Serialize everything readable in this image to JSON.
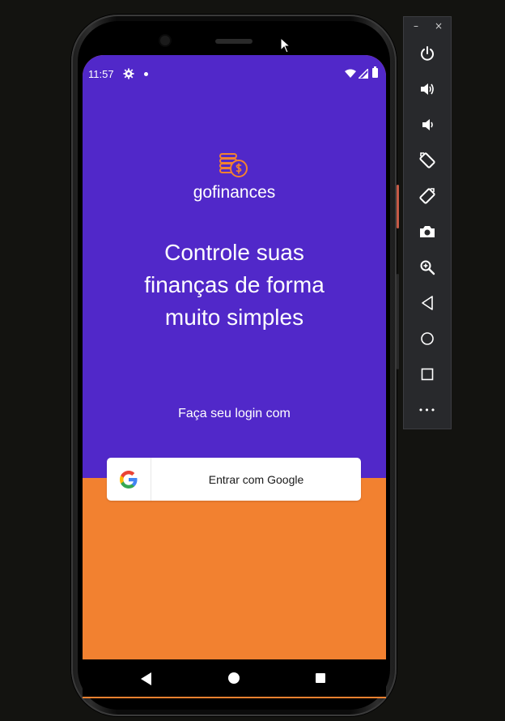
{
  "status_bar": {
    "time": "11:57"
  },
  "app": {
    "brand": "gofinances",
    "headline_line1": "Controle suas",
    "headline_line2": "finanças de forma",
    "headline_line3": "muito simples",
    "login_prompt": "Faça seu login com",
    "google_button_label": "Entrar com Google"
  },
  "colors": {
    "primary": "#5128c9",
    "secondary": "#f28130",
    "button_bg": "#ffffff"
  },
  "icons": [
    "gear-icon",
    "wifi-icon",
    "signal-icon",
    "battery-icon",
    "coins-logo-icon",
    "google-icon",
    "back-icon",
    "home-icon",
    "recents-icon",
    "power-icon",
    "volume-up-icon",
    "volume-down-icon",
    "rotate-left-icon",
    "rotate-right-icon",
    "camera-icon",
    "zoom-icon",
    "emulator-back-icon",
    "emulator-home-icon",
    "emulator-overview-icon",
    "more-icon"
  ],
  "emulator": {
    "minimize": "–",
    "close": "×",
    "more": "•••"
  }
}
